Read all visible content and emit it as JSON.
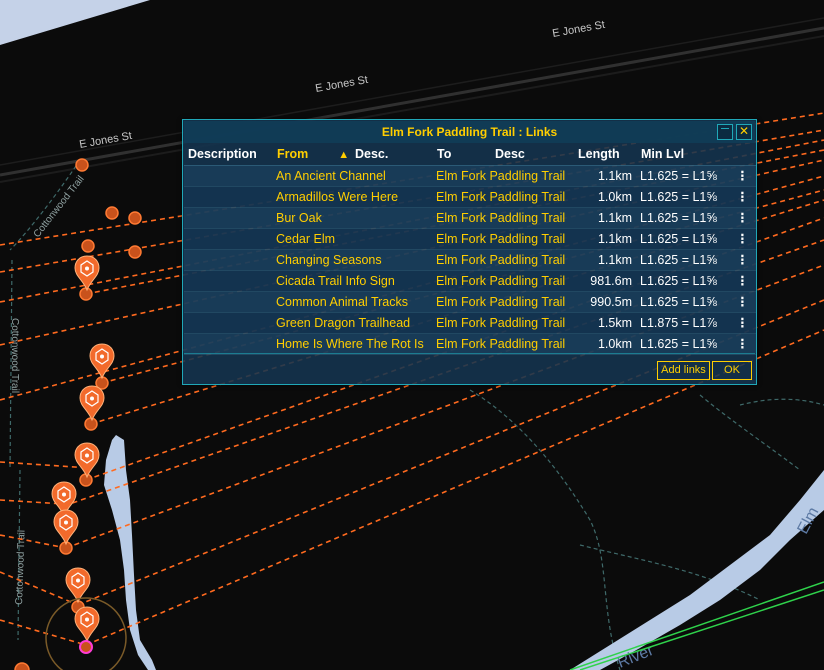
{
  "map": {
    "streets": [
      "E Jones St",
      "E Jones St",
      "E Jones St"
    ],
    "trails": [
      "Cottonwood Trail",
      "Cottonwood Trail",
      "Cottonwood Trail"
    ],
    "river_labels": [
      "Elm",
      "River"
    ],
    "colors": {
      "background": "#0b0b0b",
      "road": "#2a2a2a",
      "water": "#b8cbe6",
      "link_line": "#ff6a1f",
      "portal": "#f26a2b",
      "trail": "#3f6a6a",
      "green_link": "#2fd24b"
    }
  },
  "dialog": {
    "title": "Elm Fork Paddling Trail : Links",
    "minimize_icon": "minimize-icon",
    "close_icon": "close-icon",
    "close_glyph": "✕",
    "columns": {
      "description": "Description",
      "from": "From",
      "from_desc": "Desc.",
      "to": "To",
      "to_desc": "Desc",
      "length": "Length",
      "min_lvl": "Min Lvl"
    },
    "rows": [
      {
        "from": "An Ancient Channel",
        "to": "Elm Fork Paddling Trail",
        "length": "1.1km",
        "min_lvl": "L1.625 = L1⅝"
      },
      {
        "from": "Armadillos Were Here",
        "to": "Elm Fork Paddling Trail",
        "length": "1.0km",
        "min_lvl": "L1.625 = L1⅝"
      },
      {
        "from": "Bur Oak",
        "to": "Elm Fork Paddling Trail",
        "length": "1.1km",
        "min_lvl": "L1.625 = L1⅝"
      },
      {
        "from": "Cedar Elm",
        "to": "Elm Fork Paddling Trail",
        "length": "1.1km",
        "min_lvl": "L1.625 = L1⅝"
      },
      {
        "from": "Changing Seasons",
        "to": "Elm Fork Paddling Trail",
        "length": "1.1km",
        "min_lvl": "L1.625 = L1⅝"
      },
      {
        "from": "Cicada Trail Info Sign",
        "to": "Elm Fork Paddling Trail",
        "length": "981.6m",
        "min_lvl": "L1.625 = L1⅝"
      },
      {
        "from": "Common Animal Tracks",
        "to": "Elm Fork Paddling Trail",
        "length": "990.5m",
        "min_lvl": "L1.625 = L1⅝"
      },
      {
        "from": "Green Dragon Trailhead",
        "to": "Elm Fork Paddling Trail",
        "length": "1.5km",
        "min_lvl": "L1.875 = L1⅞"
      },
      {
        "from": "Home Is Where The Rot Is",
        "to": "Elm Fork Paddling Trail",
        "length": "1.0km",
        "min_lvl": "L1.625 = L1⅝"
      }
    ],
    "row_menu_glyph": "⋮",
    "sort_glyph": "▲",
    "buttons": {
      "add_links": "Add links",
      "ok": "OK"
    }
  }
}
